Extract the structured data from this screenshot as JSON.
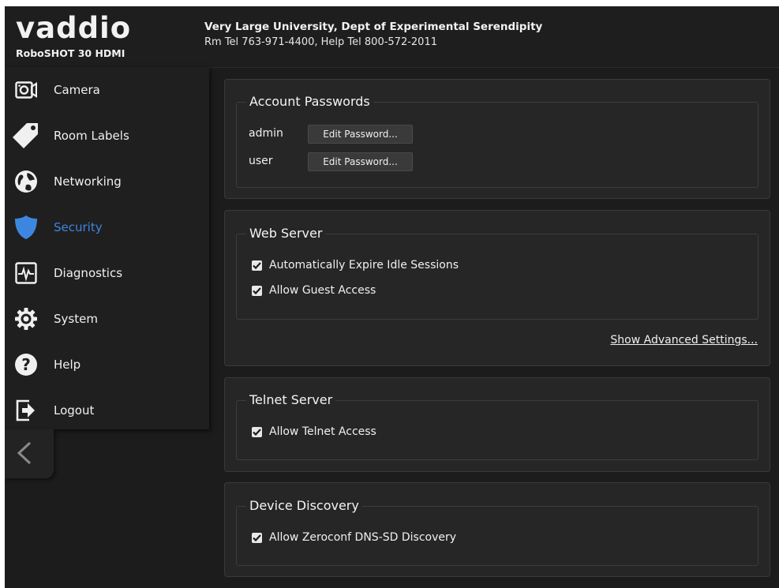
{
  "header": {
    "brand": "vaddio",
    "model": "RoboSHOT 30 HDMI",
    "room_name": "Very Large University, Dept of Experimental Serendipity",
    "phone_info": "Rm Tel 763-971-4400, Help Tel 800-572-2011"
  },
  "sidebar": {
    "items": [
      {
        "label": "Camera",
        "icon": "camera-icon"
      },
      {
        "label": "Room Labels",
        "icon": "tag-icon"
      },
      {
        "label": "Networking",
        "icon": "globe-icon"
      },
      {
        "label": "Security",
        "icon": "shield-icon",
        "active": true
      },
      {
        "label": "Diagnostics",
        "icon": "pulse-icon"
      },
      {
        "label": "System",
        "icon": "gear-icon"
      },
      {
        "label": "Help",
        "icon": "question-icon"
      },
      {
        "label": "Logout",
        "icon": "logout-icon"
      }
    ],
    "collapse_icon": "chevron-left-icon",
    "active_color": "#3d86e0"
  },
  "account_passwords": {
    "title": "Account Passwords",
    "rows": [
      {
        "user": "admin",
        "button": "Edit Password..."
      },
      {
        "user": "user",
        "button": "Edit Password..."
      }
    ]
  },
  "web_server": {
    "title": "Web Server",
    "options": [
      {
        "label": "Automatically Expire Idle Sessions",
        "checked": true
      },
      {
        "label": "Allow Guest Access",
        "checked": true
      }
    ],
    "advanced_link": "Show Advanced Settings..."
  },
  "telnet_server": {
    "title": "Telnet Server",
    "options": [
      {
        "label": "Allow Telnet Access",
        "checked": true
      }
    ]
  },
  "device_discovery": {
    "title": "Device Discovery",
    "options": [
      {
        "label": "Allow Zeroconf DNS-SD Discovery",
        "checked": true
      }
    ]
  }
}
